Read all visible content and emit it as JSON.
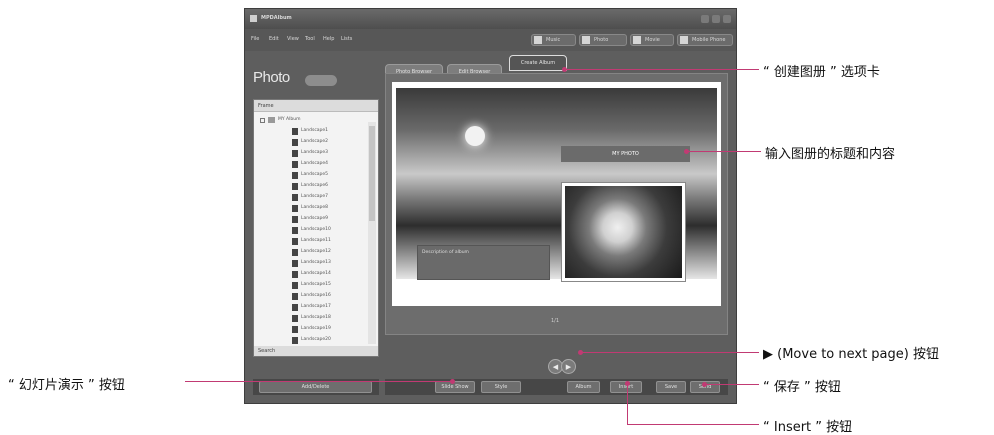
{
  "window": {
    "title": "MPDAlbum",
    "menu": [
      "File",
      "Edit",
      "View",
      "Tool",
      "Help",
      "Lists"
    ],
    "top_buttons": [
      "Music",
      "Photo",
      "Movie",
      "Mobile Phone"
    ]
  },
  "sidebar": {
    "heading": "Photo",
    "tree_header": "Frame",
    "tree_footer": "Search",
    "tree_root": "MY Album",
    "tree_items": [
      "Landscape1",
      "Landscape2",
      "Landscape3",
      "Landscape4",
      "Landscape5",
      "Landscape6",
      "Landscape7",
      "Landscape8",
      "Landscape9",
      "Landscape10",
      "Landscape11",
      "Landscape12",
      "Landscape13",
      "Landscape14",
      "Landscape15",
      "Landscape16",
      "Landscape17",
      "Landscape18",
      "Landscape19",
      "Landscape20"
    ]
  },
  "tabs": [
    "Photo Browser",
    "Edit Browser",
    "Create Album"
  ],
  "album": {
    "title_box": "MY PHOTO",
    "text_box": "Description of album",
    "page_number": "1/1"
  },
  "nav": {
    "prev": "◀",
    "next": "▶"
  },
  "bottom_buttons": [
    "Add/Delete",
    "Slide Show",
    "Style",
    "Album",
    "Insert",
    "Save",
    "Send"
  ],
  "annotations": {
    "create_album_tab": "“ 创建图册 ” 选项卡",
    "input_title": "输入图册的标题和内容",
    "next_page": "▶ (Move to next page) 按钮",
    "save": "“ 保存 ” 按钮",
    "insert": "“ Insert ” 按钮",
    "slideshow": "“ 幻灯片演示 ” 按钮"
  },
  "colors": {
    "callout": "#c13a73",
    "window": "#5e5e5e"
  }
}
